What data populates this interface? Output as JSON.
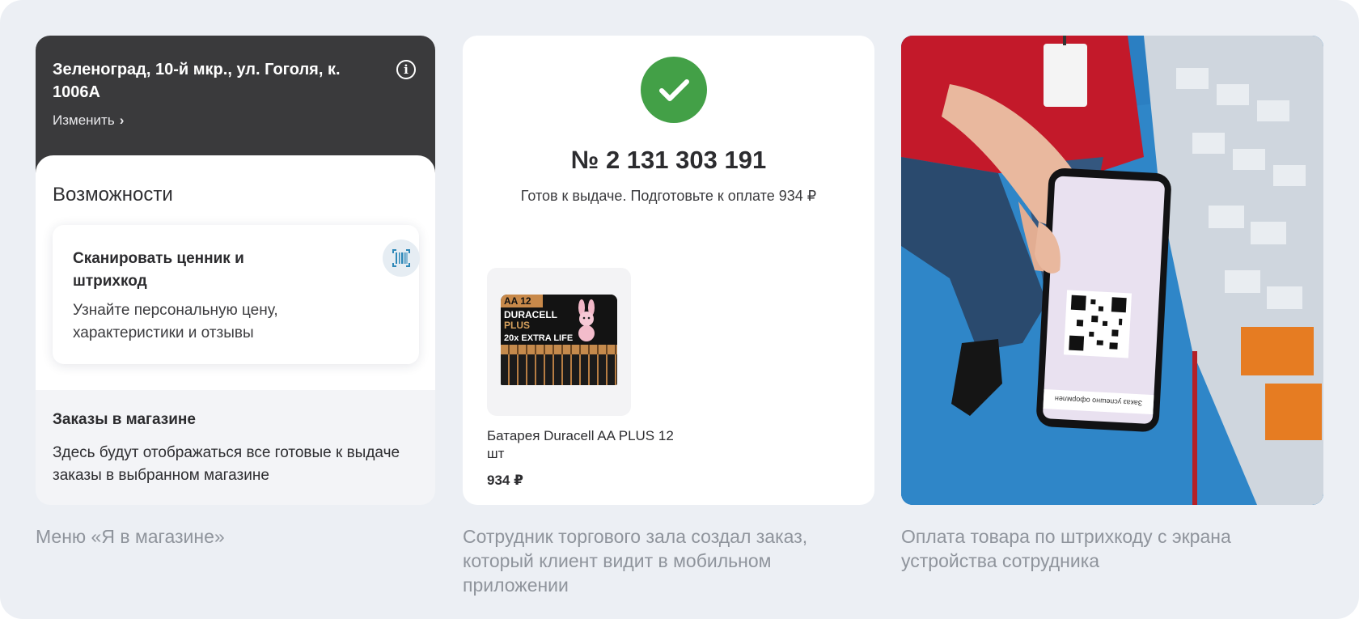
{
  "panel_store_menu": {
    "address": "Зеленоград, 10-й мкр., ул. Гоголя, к. 1006А",
    "change_label": "Изменить",
    "info_icon": "info-icon",
    "features_title": "Возможности",
    "scan_card": {
      "title": "Сканировать ценник и штрихкод",
      "description": "Узнайте персональную цену, характеристики и отзывы",
      "icon": "barcode-scan-icon"
    },
    "orders_title": "Заказы в магазине",
    "orders_description": "Здесь будут отображаться все готовые к выдаче заказы в выбранном магазине"
  },
  "panel_order": {
    "status_icon": "check-icon",
    "order_number": "№ 2 131 303 191",
    "status_text": "Готов к выдаче. Подготовьте к оплате 934 ₽",
    "product": {
      "name": "Батарея Duracell AA PLUS 12 шт",
      "price": "934 ₽",
      "image": "duracell-pack-image",
      "pack_size_label": "AA 12",
      "pack_brand": "DURACELL",
      "pack_line": "PLUS",
      "pack_claim": "20x EXTRA LIFE"
    }
  },
  "panel_photo": {
    "image": "employee-phone-qr-photo",
    "phone_screen_caption": "Заказ успешно оформлен"
  },
  "captions": [
    "Меню «Я в магазине»",
    "Сотрудник торгового зала создал заказ, который клиент видит в мобильном приложении",
    "Оплата товара по штрихкоду с экрана устройства сотрудника"
  ],
  "colors": {
    "background": "#eceff4",
    "header_dark": "#3a3a3c",
    "success_green": "#43a047",
    "caption_gray": "#8f949c"
  }
}
